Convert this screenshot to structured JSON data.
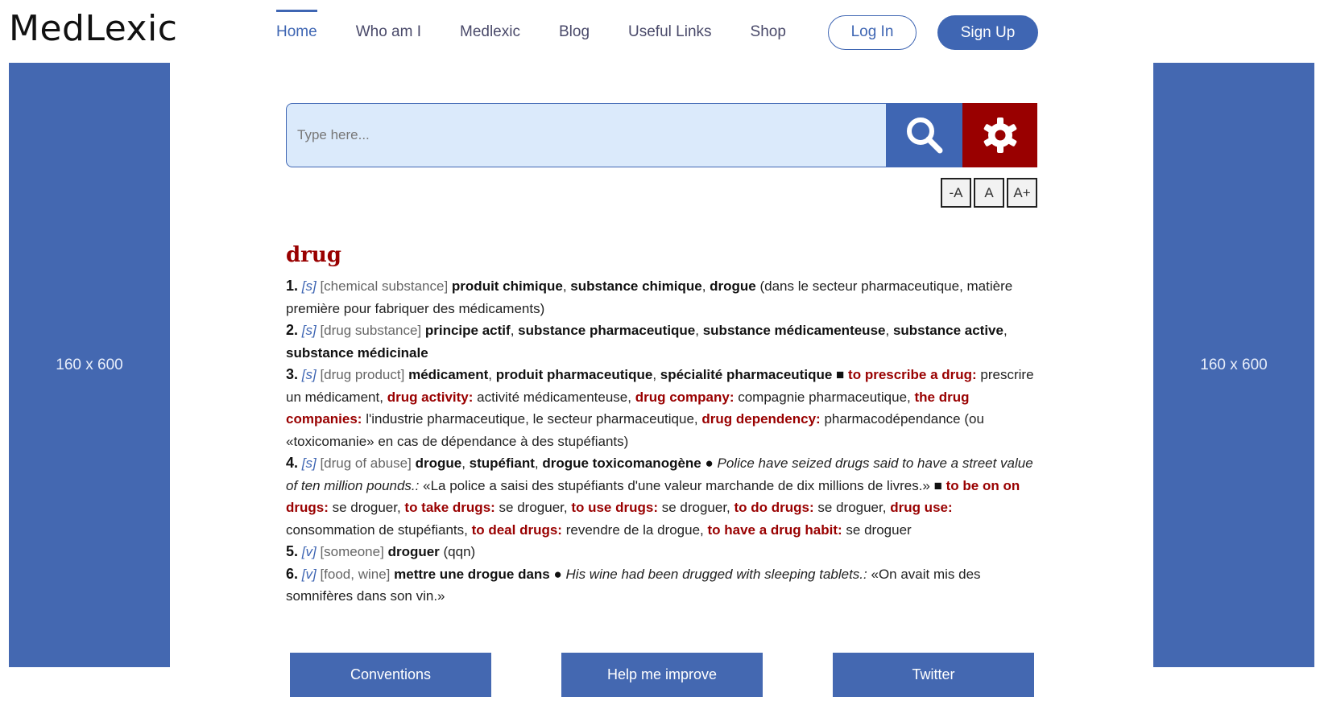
{
  "logo": "MedLexic",
  "nav": {
    "items": [
      {
        "label": "Home"
      },
      {
        "label": "Who am I"
      },
      {
        "label": "Medlexic"
      },
      {
        "label": "Blog"
      },
      {
        "label": "Useful Links"
      },
      {
        "label": "Shop"
      }
    ],
    "login": "Log In",
    "signup": "Sign Up"
  },
  "ads": {
    "left": "160 x 600",
    "right": "160 x 600"
  },
  "search": {
    "placeholder": "Type here..."
  },
  "font_controls": [
    "-A",
    "A",
    "A+"
  ],
  "entry": {
    "headword": "drug",
    "senses": [
      {
        "num": "1.",
        "pos": "[s]",
        "context": "[chemical substance]"
      },
      {
        "num": "2.",
        "pos": "[s]",
        "context": "[drug substance]"
      },
      {
        "num": "3.",
        "pos": "[s]",
        "context": "[drug product]"
      },
      {
        "num": "4.",
        "pos": "[s]",
        "context": "[drug of abuse]"
      },
      {
        "num": "5.",
        "pos": "[v]",
        "context": "[someone]"
      },
      {
        "num": "6.",
        "pos": "[v]",
        "context": "[food, wine]"
      }
    ],
    "s1": {
      "t1": "produit chimique",
      "t2": "substance chimique",
      "t3": "drogue",
      "note": " (dans le secteur pharmaceutique, matière première pour fabriquer des médicaments)"
    },
    "s2": {
      "t1": "principe actif",
      "t2": "substance pharmaceutique",
      "t3": "substance médicamenteuse",
      "t4": "substance active",
      "t5": "substance médicinale"
    },
    "s3": {
      "t1": "médicament",
      "t2": "produit pharmaceutique",
      "t3": "spécialité pharmaceutique",
      "p1": "to prescribe a drug:",
      "p1t": " prescrire un médicament, ",
      "p2": "drug activity:",
      "p2t": " activité médicamenteuse, ",
      "p3": "drug company:",
      "p3t": " compagnie pharmaceutique, ",
      "p4": "the drug companies:",
      "p4t": " l'industrie pharmaceutique, le secteur pharmaceutique, ",
      "p5": "drug dependency:",
      "p5t": " pharmacodépendance (ou «toxicomanie» en cas de dépendance à des stupéfiants)"
    },
    "s4": {
      "t1": "drogue",
      "t2": "stupéfiant",
      "t3": "drogue toxicomanogène",
      "ex": "Police have seized drugs said to have a street value of ten million pounds.:",
      "ex_tr": " «La police a saisi des stupéfiants d'une valeur marchande de dix millions de livres.» ",
      "p1": "to be on on drugs:",
      "p1t": " se droguer, ",
      "p2": "to take drugs:",
      "p2t": " se droguer, ",
      "p3": "to use drugs:",
      "p3t": " se droguer, ",
      "p4": "to do drugs:",
      "p4t": " se droguer, ",
      "p5": "drug use:",
      "p5t": " consommation de stupéfiants, ",
      "p6": "to deal drugs:",
      "p6t": " revendre de la drogue, ",
      "p7": "to have a drug habit:",
      "p7t": " se droguer"
    },
    "s5": {
      "t1": "droguer",
      "note": " (qqn)"
    },
    "s6": {
      "t1": "mettre une drogue dans",
      "ex": "His wine had been drugged with sleeping tablets.:",
      "ex_tr": " «On avait mis des somnifères dans son vin.»"
    }
  },
  "footer": [
    "Conventions",
    "Help me improve",
    "Twitter"
  ]
}
